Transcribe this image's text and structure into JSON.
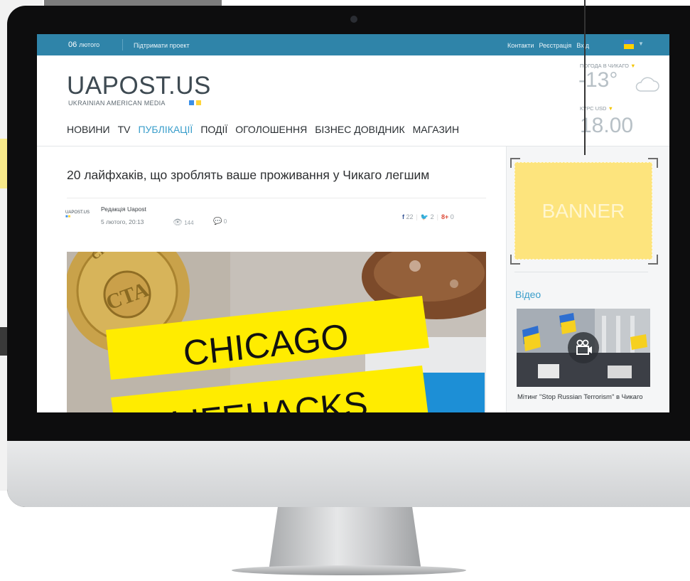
{
  "topbar": {
    "day": "06",
    "month": "лютого",
    "support_label": "Підтримати проект",
    "links": [
      "Контакти",
      "Реєстрація",
      "Вхід"
    ]
  },
  "logo": {
    "title": "UAPOST.US",
    "subtitle": "UKRAINIAN AMERICAN MEDIA"
  },
  "nav": {
    "items": [
      "НОВИНИ",
      "TV",
      "ПУБЛІКАЦІЇ",
      "ПОДІЇ",
      "ОГОЛОШЕННЯ",
      "БІЗНЕС ДОВІДНИК",
      "МАГАЗИН"
    ],
    "active_index": 2
  },
  "weather": {
    "label": "ПОГОДА В ЧИКАГО",
    "temperature": "-13°"
  },
  "currency": {
    "label": "КУРС USD",
    "value": "18.00"
  },
  "article": {
    "title": "20 лайфхаків, що зроблять ваше проживання у Чикаго легшим",
    "author_logo": "UAPOST.US",
    "author": "Редакція Uapost",
    "time": "5 лютого, 20:13",
    "views": "144",
    "comments": "0",
    "shares": {
      "facebook": "22",
      "twitter": "2",
      "gplus": "0"
    }
  },
  "hero": {
    "token_text": "CTA",
    "token_ring": "CHICAGO",
    "line1": "CHICAGO",
    "line2": "LIFEHACKS"
  },
  "sidebar": {
    "banner_label": "BANNER",
    "video_section_title": "Відео",
    "video_caption": "Мітинг \"Stop Russian Terrorism\" в Чикаго"
  },
  "colors": {
    "topbar": "#2f84a9",
    "accent": "#3a9ecb",
    "banner": "#fde47d",
    "hero_yellow": "#ffec00"
  }
}
